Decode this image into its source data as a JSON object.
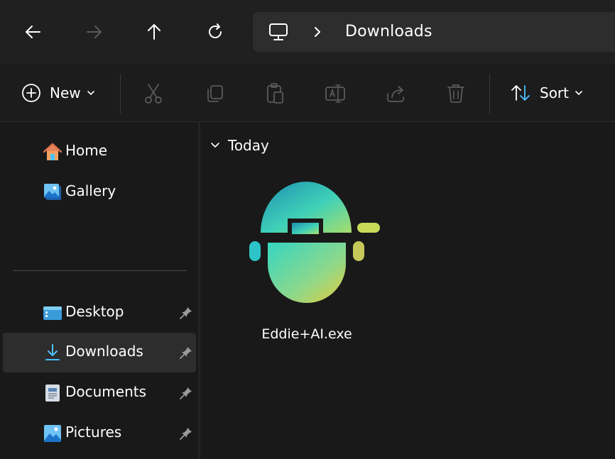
{
  "address": {
    "breadcrumb": "Downloads",
    "icons": {
      "location": "pc-monitor-icon",
      "separator": "chevron-right-icon"
    }
  },
  "nav": {
    "icons": [
      "back-arrow-icon",
      "forward-arrow-icon",
      "up-arrow-icon",
      "refresh-icon"
    ],
    "forward_enabled": false
  },
  "toolbar": {
    "new_label": "New",
    "sort_label": "Sort",
    "icons": [
      "plus-circle-icon",
      "cut-icon",
      "copy-icon",
      "paste-icon",
      "rename-icon",
      "share-icon",
      "delete-icon",
      "sort-icon"
    ]
  },
  "sidebar": {
    "items": [
      {
        "label": "Home",
        "icon": "home-icon",
        "pinned": false,
        "selected": false
      },
      {
        "label": "Gallery",
        "icon": "gallery-icon",
        "pinned": false,
        "selected": false
      },
      {
        "label": "Desktop",
        "icon": "desktop-folder-icon",
        "pinned": true,
        "selected": false
      },
      {
        "label": "Downloads",
        "icon": "download-icon",
        "pinned": true,
        "selected": true
      },
      {
        "label": "Documents",
        "icon": "documents-icon",
        "pinned": true,
        "selected": false
      },
      {
        "label": "Pictures",
        "icon": "pictures-icon",
        "pinned": true,
        "selected": false
      }
    ]
  },
  "main": {
    "group": {
      "label": "Today",
      "expanded": true
    },
    "files": [
      {
        "name": "Eddie+AI.exe",
        "icon": "eddie-ai-app-icon"
      }
    ]
  },
  "colors": {
    "window_bg": "#191919",
    "titlebar_bg": "#202020",
    "address_bg": "#2d2d2d",
    "selected_bg": "#2d2d2d",
    "accent": "#4cc2ff",
    "disabled_icon": "#5a5a5a"
  }
}
